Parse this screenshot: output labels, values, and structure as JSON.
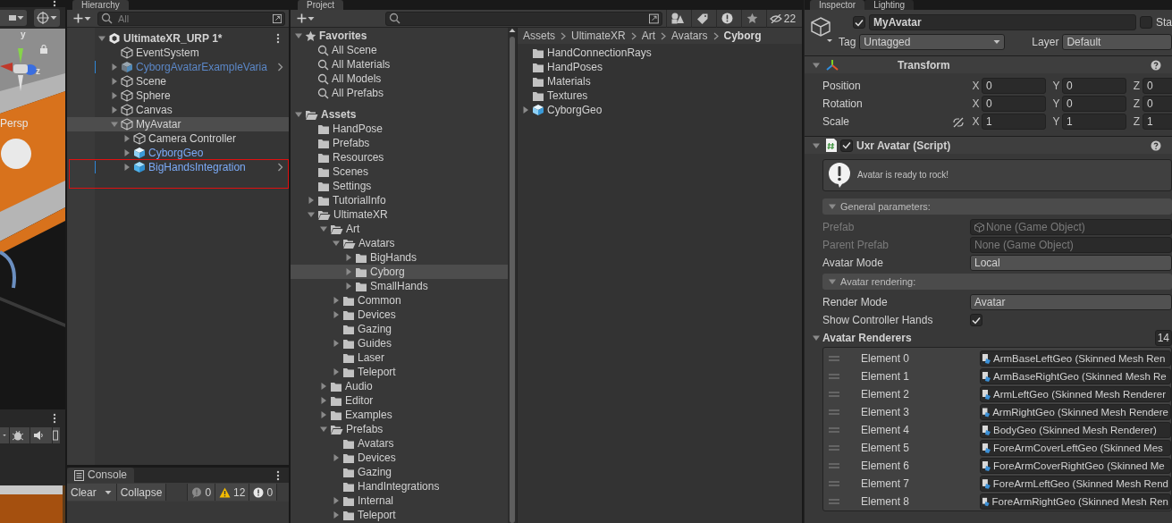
{
  "scene_view": {
    "camera_label": "Persp",
    "gizmo_labels": [
      "y",
      "z"
    ],
    "locked": true
  },
  "hierarchy": {
    "title": "Hierarchy",
    "search": {
      "placeholder": "All"
    },
    "items": [
      {
        "label": "UltimateXR_URP 1*",
        "kind": "scene",
        "expandable": true,
        "expanded": true,
        "selected": false,
        "modified": false,
        "boxed": false,
        "children": [
          {
            "label": "EventSystem",
            "kind": "object",
            "expandable": false,
            "selected": false,
            "modified": false,
            "boxed": false
          },
          {
            "label": "CyborgAvatarExampleVaria",
            "kind": "prefab_variant",
            "expandable": true,
            "expanded": false,
            "selected": false,
            "modified": true,
            "boxed": false
          },
          {
            "label": "Scene",
            "kind": "object",
            "expandable": true,
            "expanded": false,
            "selected": false,
            "modified": false,
            "boxed": false
          },
          {
            "label": "Sphere",
            "kind": "object",
            "expandable": true,
            "expanded": false,
            "selected": false,
            "modified": false,
            "boxed": false
          },
          {
            "label": "Canvas",
            "kind": "object",
            "expandable": true,
            "expanded": false,
            "selected": false,
            "modified": false,
            "boxed": false
          },
          {
            "label": "MyAvatar",
            "kind": "object",
            "expandable": true,
            "expanded": true,
            "selected": true,
            "modified": false,
            "boxed": false,
            "children": [
              {
                "label": "Camera Controller",
                "kind": "object",
                "expandable": true,
                "expanded": false,
                "selected": false,
                "modified": false,
                "boxed": false
              },
              {
                "label": "CyborgGeo",
                "kind": "model",
                "expandable": true,
                "expanded": false,
                "selected": false,
                "modified": false,
                "boxed": false
              },
              {
                "label": "BigHandsIntegration",
                "kind": "prefab",
                "expandable": true,
                "expanded": false,
                "selected": false,
                "modified": true,
                "boxed": true
              }
            ]
          }
        ]
      }
    ]
  },
  "console": {
    "title": "Console",
    "clear": "Clear",
    "collapse": "Collapse",
    "counts": [
      {
        "kind": "info",
        "text": "0"
      },
      {
        "kind": "warning",
        "text": "12"
      },
      {
        "kind": "error",
        "text": "0"
      }
    ]
  },
  "project": {
    "title": "Project",
    "hidden_count": "22",
    "favorites": {
      "label": "Favorites",
      "expanded": true,
      "items": [
        "All Scene",
        "All Materials",
        "All Models",
        "All Prefabs"
      ]
    },
    "tree": [
      {
        "label": "Assets",
        "expandable": true,
        "expanded": true,
        "selected": false,
        "children": [
          {
            "label": "HandPose",
            "expandable": false,
            "selected": false
          },
          {
            "label": "Prefabs",
            "expandable": false,
            "selected": false
          },
          {
            "label": "Resources",
            "expandable": false,
            "selected": false
          },
          {
            "label": "Scenes",
            "expandable": false,
            "selected": false
          },
          {
            "label": "Settings",
            "expandable": false,
            "selected": false
          },
          {
            "label": "TutorialInfo",
            "expandable": true,
            "expanded": false,
            "selected": false
          },
          {
            "label": "UltimateXR",
            "expandable": true,
            "expanded": true,
            "selected": false,
            "children": [
              {
                "label": "Art",
                "expandable": true,
                "expanded": true,
                "selected": false,
                "children": [
                  {
                    "label": "Avatars",
                    "expandable": true,
                    "expanded": true,
                    "selected": false,
                    "children": [
                      {
                        "label": "BigHands",
                        "expandable": true,
                        "expanded": false,
                        "selected": false
                      },
                      {
                        "label": "Cyborg",
                        "expandable": true,
                        "expanded": false,
                        "selected": true
                      },
                      {
                        "label": "SmallHands",
                        "expandable": true,
                        "expanded": false,
                        "selected": false
                      }
                    ]
                  },
                  {
                    "label": "Common",
                    "expandable": true,
                    "expanded": false,
                    "selected": false
                  },
                  {
                    "label": "Devices",
                    "expandable": true,
                    "expanded": false,
                    "selected": false
                  },
                  {
                    "label": "Gazing",
                    "expandable": false,
                    "selected": false
                  },
                  {
                    "label": "Guides",
                    "expandable": true,
                    "expanded": false,
                    "selected": false
                  },
                  {
                    "label": "Laser",
                    "expandable": false,
                    "selected": false
                  },
                  {
                    "label": "Teleport",
                    "expandable": true,
                    "expanded": false,
                    "selected": false
                  }
                ]
              },
              {
                "label": "Audio",
                "expandable": true,
                "expanded": false,
                "selected": false
              },
              {
                "label": "Editor",
                "expandable": true,
                "expanded": false,
                "selected": false
              },
              {
                "label": "Examples",
                "expandable": true,
                "expanded": false,
                "selected": false
              },
              {
                "label": "Prefabs",
                "expandable": true,
                "expanded": true,
                "selected": false,
                "children": [
                  {
                    "label": "Avatars",
                    "expandable": false,
                    "selected": false
                  },
                  {
                    "label": "Devices",
                    "expandable": true,
                    "expanded": false,
                    "selected": false
                  },
                  {
                    "label": "Gazing",
                    "expandable": false,
                    "selected": false
                  },
                  {
                    "label": "HandIntegrations",
                    "expandable": false,
                    "selected": false
                  },
                  {
                    "label": "Internal",
                    "expandable": true,
                    "expanded": false,
                    "selected": false
                  },
                  {
                    "label": "Teleport",
                    "expandable": true,
                    "expanded": false,
                    "selected": false
                  }
                ]
              }
            ]
          }
        ]
      }
    ],
    "breadcrumb": [
      "Assets",
      "UltimateXR",
      "Art",
      "Avatars",
      "Cyborg"
    ],
    "items": [
      {
        "label": "HandConnectionRays",
        "kind": "folder",
        "expandable": false
      },
      {
        "label": "HandPoses",
        "kind": "folder",
        "expandable": false
      },
      {
        "label": "Materials",
        "kind": "folder",
        "expandable": false
      },
      {
        "label": "Textures",
        "kind": "folder",
        "expandable": false
      },
      {
        "label": "CyborgGeo",
        "kind": "model",
        "expandable": true
      }
    ]
  },
  "inspector": {
    "tabs": [
      {
        "label": "Inspector",
        "selected": true
      },
      {
        "label": "Lighting",
        "selected": false
      }
    ],
    "object": {
      "active": true,
      "name": "MyAvatar",
      "static": false,
      "static_label": "Sta",
      "tag_label": "Tag",
      "tag": "Untagged",
      "layer_label": "Layer",
      "layer": "Default"
    },
    "components": [
      {
        "kind": "transform",
        "title": "Transform",
        "expanded": true,
        "rows": [
          {
            "label": "Position",
            "constrain_toggle": false,
            "values": [
              {
                "axis": "X",
                "value": "0"
              },
              {
                "axis": "Y",
                "value": "0"
              },
              {
                "axis": "Z",
                "value": "0"
              }
            ]
          },
          {
            "label": "Rotation",
            "constrain_toggle": false,
            "values": [
              {
                "axis": "X",
                "value": "0"
              },
              {
                "axis": "Y",
                "value": "0"
              },
              {
                "axis": "Z",
                "value": "0"
              }
            ]
          },
          {
            "label": "Scale",
            "constrain_toggle": true,
            "values": [
              {
                "axis": "X",
                "value": "1"
              },
              {
                "axis": "Y",
                "value": "1"
              },
              {
                "axis": "Z",
                "value": "1"
              }
            ]
          }
        ]
      },
      {
        "kind": "script",
        "title": "Uxr Avatar (Script)",
        "enabled": true,
        "expanded": true,
        "help": "Avatar is ready to rock!",
        "fields": [
          {
            "kind": "section",
            "label": "General parameters:",
            "expanded": true
          },
          {
            "kind": "object",
            "label": "Prefab",
            "value": "None (Game Object)",
            "icon": true,
            "disabled": true
          },
          {
            "kind": "object",
            "label": "Parent Prefab",
            "value": "None (Game Object)",
            "icon": false,
            "disabled": true
          },
          {
            "kind": "dropdown",
            "label": "Avatar Mode",
            "value": "Local",
            "disabled": false
          },
          {
            "kind": "section",
            "label": "Avatar rendering:",
            "expanded": true
          },
          {
            "kind": "dropdown",
            "label": "Render Mode",
            "value": "Avatar",
            "disabled": false
          },
          {
            "kind": "toggle",
            "label": "Show Controller Hands",
            "checked": true,
            "disabled": false
          },
          {
            "kind": "list",
            "label": "Avatar Renderers",
            "count": "14",
            "expanded": true,
            "elements": [
              {
                "label": "Element 0",
                "value": "ArmBaseLeftGeo (Skinned Mesh Ren"
              },
              {
                "label": "Element 1",
                "value": "ArmBaseRightGeo (Skinned Mesh Re"
              },
              {
                "label": "Element 2",
                "value": "ArmLeftGeo (Skinned Mesh Renderer"
              },
              {
                "label": "Element 3",
                "value": "ArmRightGeo (Skinned Mesh Rendere"
              },
              {
                "label": "Element 4",
                "value": "BodyGeo (Skinned Mesh Renderer)"
              },
              {
                "label": "Element 5",
                "value": "ForeArmCoverLeftGeo (Skinned Mes"
              },
              {
                "label": "Element 6",
                "value": "ForeArmCoverRightGeo (Skinned Me"
              },
              {
                "label": "Element 7",
                "value": "ForeArmLeftGeo (Skinned Mesh Rend"
              },
              {
                "label": "Element 8",
                "value": "ForeArmRightGeo (Skinned Mesh Ren"
              }
            ]
          }
        ]
      }
    ]
  }
}
